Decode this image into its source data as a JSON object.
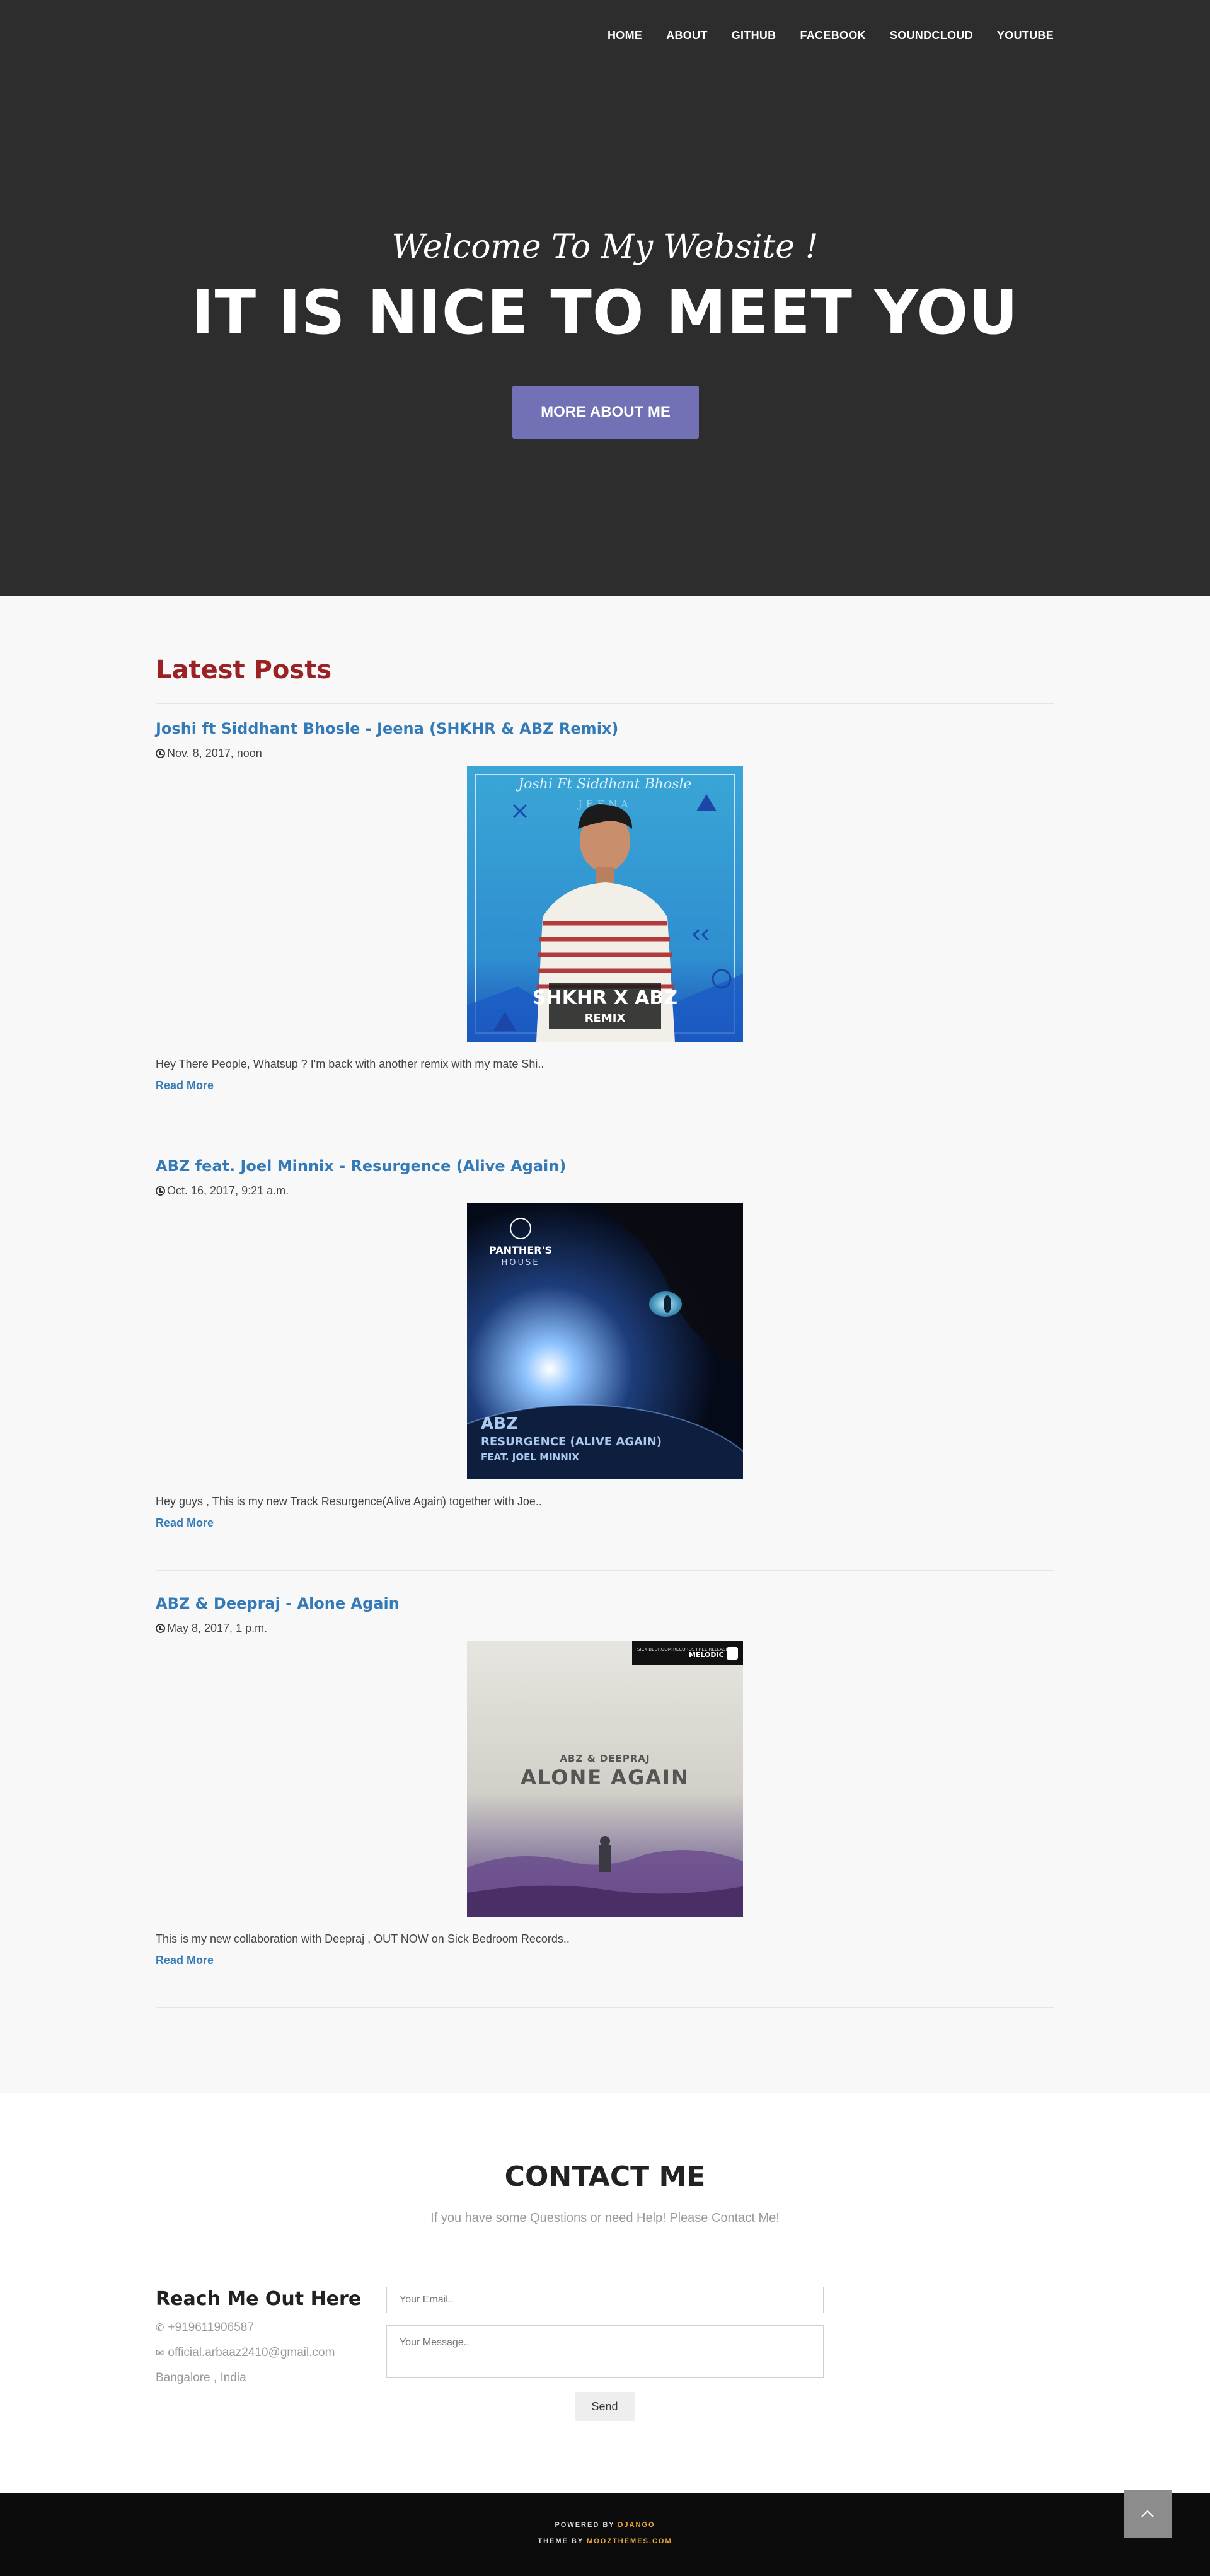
{
  "nav": {
    "items": [
      "HOME",
      "ABOUT",
      "GITHUB",
      "FACEBOOK",
      "SOUNDCLOUD",
      "YOUTUBE"
    ]
  },
  "hero": {
    "subtitle": "Welcome To My Website !",
    "title": "IT IS NICE TO MEET YOU",
    "button": "MORE ABOUT ME",
    "accent_color": "#7271b5",
    "background_color": "#2d2d2d"
  },
  "posts": {
    "heading": "Latest Posts",
    "read_more": "Read More",
    "items": [
      {
        "title": "Joshi ft Siddhant Bhosle - Jeena (SHKHR & ABZ Remix)",
        "date": "Nov. 8, 2017, noon",
        "excerpt": "Hey There People, Whatsup ? I'm back with another remix with my mate Shi..",
        "cover": {
          "artist_line": "Joshi Ft Siddhant Bhosle",
          "title_line": "JEENA",
          "badge": "SHKHR X ABZ",
          "badge_sub": "REMIX"
        }
      },
      {
        "title": "ABZ feat. Joel Minnix - Resurgence (Alive Again)",
        "date": "Oct. 16, 2017, 9:21 a.m.",
        "excerpt": "Hey guys , This is my new Track Resurgence(Alive Again) together with Joe..",
        "cover": {
          "label_top": "PANTHER'S",
          "label_bottom": "HOUSE",
          "artist": "ABZ",
          "track": "RESURGENCE (ALIVE AGAIN)",
          "feat": "FEAT. JOEL MINNIX"
        }
      },
      {
        "title": "ABZ & Deepraj - Alone Again",
        "date": "May 8, 2017, 1 p.m.",
        "excerpt": "This is my new collaboration with Deepraj , OUT NOW on Sick Bedroom Records..",
        "cover": {
          "label_left": "SICK BEDROOM RECORDS FREE RELEASE",
          "label_right": "MELODIC",
          "artist": "ABZ & DEEPRAJ",
          "track": "ALONE AGAIN"
        }
      }
    ]
  },
  "contact": {
    "title": "CONTACT ME",
    "subtitle": "If you have some Questions or need Help! Please Contact Me!",
    "reach_title": "Reach Me Out Here",
    "phone": "+919611906587",
    "email": "official.arbaaz2410@gmail.com",
    "location": "Bangalore , India",
    "email_placeholder": "Your Email..",
    "message_placeholder": "Your Message..",
    "send": "Send"
  },
  "footer": {
    "powered_prefix": "POWERED BY",
    "powered_link": "DJANGO",
    "theme_prefix": "THEME BY",
    "theme_link": "MOOZTHEMES.COM",
    "link_color": "#e9a83d"
  },
  "to_top": {
    "icon": "chevron-up-icon"
  }
}
